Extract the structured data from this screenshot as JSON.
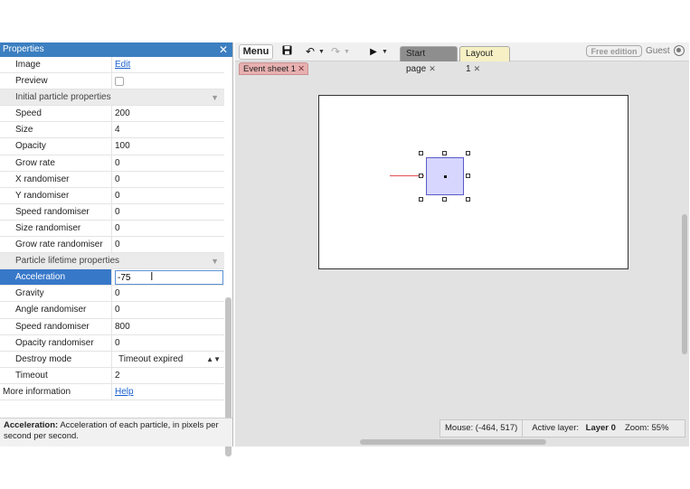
{
  "properties": {
    "title": "Properties",
    "rows_top": [
      {
        "label": "Image",
        "value": "Edit",
        "kind": "link"
      },
      {
        "label": "Preview",
        "value": "",
        "kind": "checkbox"
      }
    ],
    "section1": "Initial particle properties",
    "initial": [
      {
        "label": "Speed",
        "value": "200"
      },
      {
        "label": "Size",
        "value": "4"
      },
      {
        "label": "Opacity",
        "value": "100"
      },
      {
        "label": "Grow rate",
        "value": "0"
      },
      {
        "label": "X randomiser",
        "value": "0"
      },
      {
        "label": "Y randomiser",
        "value": "0"
      },
      {
        "label": "Speed randomiser",
        "value": "0"
      },
      {
        "label": "Size randomiser",
        "value": "0"
      },
      {
        "label": "Grow rate randomiser",
        "value": "0"
      }
    ],
    "section2": "Particle lifetime properties",
    "acceleration": {
      "label": "Acceleration",
      "value": "-75"
    },
    "lifetime": [
      {
        "label": "Gravity",
        "value": "0"
      },
      {
        "label": "Angle randomiser",
        "value": "0"
      },
      {
        "label": "Speed randomiser",
        "value": "800"
      },
      {
        "label": "Opacity randomiser",
        "value": "0"
      }
    ],
    "destroy": {
      "label": "Destroy mode",
      "value": "Timeout expired"
    },
    "timeout": {
      "label": "Timeout",
      "value": "2"
    },
    "more": {
      "label": "More information",
      "value": "Help"
    },
    "description_title": "Acceleration:",
    "description_text": "Acceleration of each particle, in pixels per second per second."
  },
  "toolbar": {
    "menu_label": "Menu",
    "save_icon": "floppy-icon",
    "undo_icon": "undo-icon",
    "redo_icon": "redo-icon",
    "play_icon": "play-icon",
    "tabs": [
      {
        "label": "Start page",
        "active": false
      },
      {
        "label": "Layout 1",
        "active": true
      }
    ],
    "edition_badge": "Free edition",
    "user_label": "Guest"
  },
  "subtab": {
    "label": "Event sheet 1"
  },
  "status": {
    "mouse": "Mouse: (-464, 517)",
    "layer_prefix": "Active layer:",
    "layer_name": "Layer 0",
    "zoom": "Zoom: 55%"
  },
  "colors": {
    "titlebar": "#3c7fc1",
    "selection": "#3778c9",
    "layout_tab": "#f6f0c4",
    "event_tab": "#e8b0b0",
    "sprite_fill": "#d6d6ff"
  }
}
